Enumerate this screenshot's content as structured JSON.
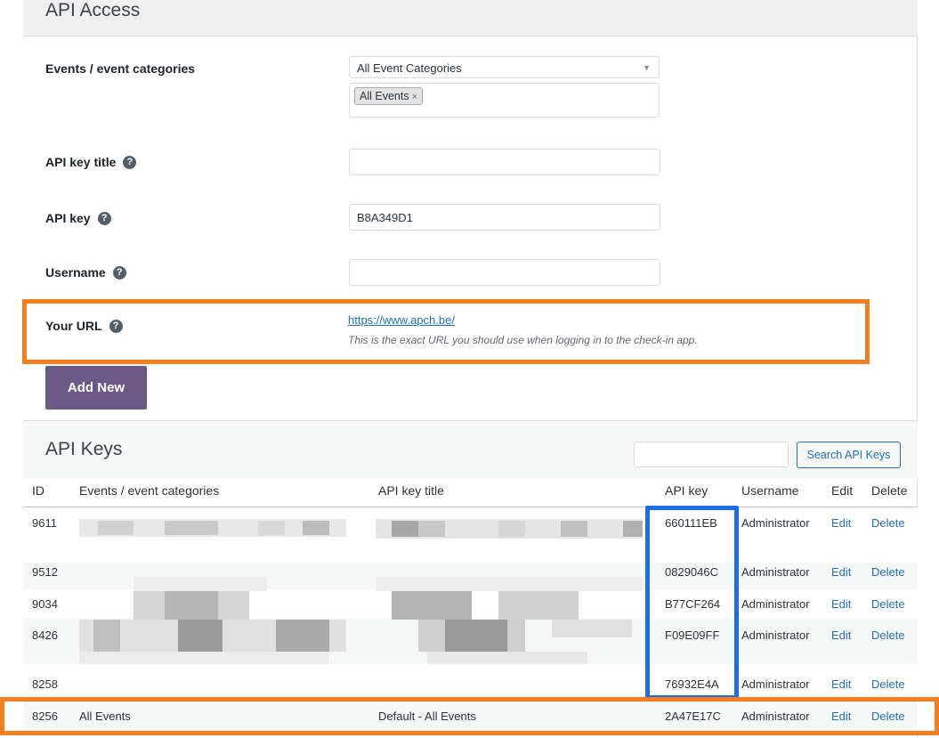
{
  "access": {
    "title": "API Access",
    "events_label": "Events / event categories",
    "events_select": "All Event Categories",
    "events_tag": "All Events",
    "tag_remove": "×",
    "api_key_title_label": "API key title",
    "api_key_title_value": "",
    "api_key_label": "API key",
    "api_key_value": "B8A349D1",
    "username_label": "Username",
    "username_value": "",
    "url_label": "Your URL",
    "url_value": "https://www.apch.be/",
    "url_description": "This is the exact URL you should use when logging in to the check-in app.",
    "help_glyph": "?",
    "add_button": "Add New"
  },
  "keys": {
    "title": "API Keys",
    "search_value": "",
    "search_button": "Search API Keys",
    "columns": {
      "id": "ID",
      "events": "Events / event categories",
      "title": "API key title",
      "key": "API key",
      "username": "Username",
      "edit": "Edit",
      "delete": "Delete"
    },
    "rows": [
      {
        "id": "9611",
        "events": "",
        "title": "",
        "key": "660111EB",
        "username": "Administrator",
        "edit": "Edit",
        "delete": "Delete"
      },
      {
        "id": "9512",
        "events": "",
        "title": "",
        "key": "0829046C",
        "username": "Administrator",
        "edit": "Edit",
        "delete": "Delete"
      },
      {
        "id": "9034",
        "events": "",
        "title": "",
        "key": "B77CF264",
        "username": "Administrator",
        "edit": "Edit",
        "delete": "Delete"
      },
      {
        "id": "8426",
        "events": "",
        "title": "",
        "key": "F09E09FF",
        "username": "Administrator",
        "edit": "Edit",
        "delete": "Delete"
      },
      {
        "id": "8258",
        "events": "",
        "title": "",
        "key": "76932E4A",
        "username": "Administrator",
        "edit": "Edit",
        "delete": "Delete"
      },
      {
        "id": "8256",
        "events": "All Events",
        "title": "Default - All Events",
        "key": "2A47E17C",
        "username": "Administrator",
        "edit": "Edit",
        "delete": "Delete"
      }
    ]
  },
  "colors": {
    "highlight_orange": "#f57f20",
    "highlight_blue": "#1a6fe8",
    "button_purple": "#6b5a86",
    "link_blue": "#2271b1"
  }
}
